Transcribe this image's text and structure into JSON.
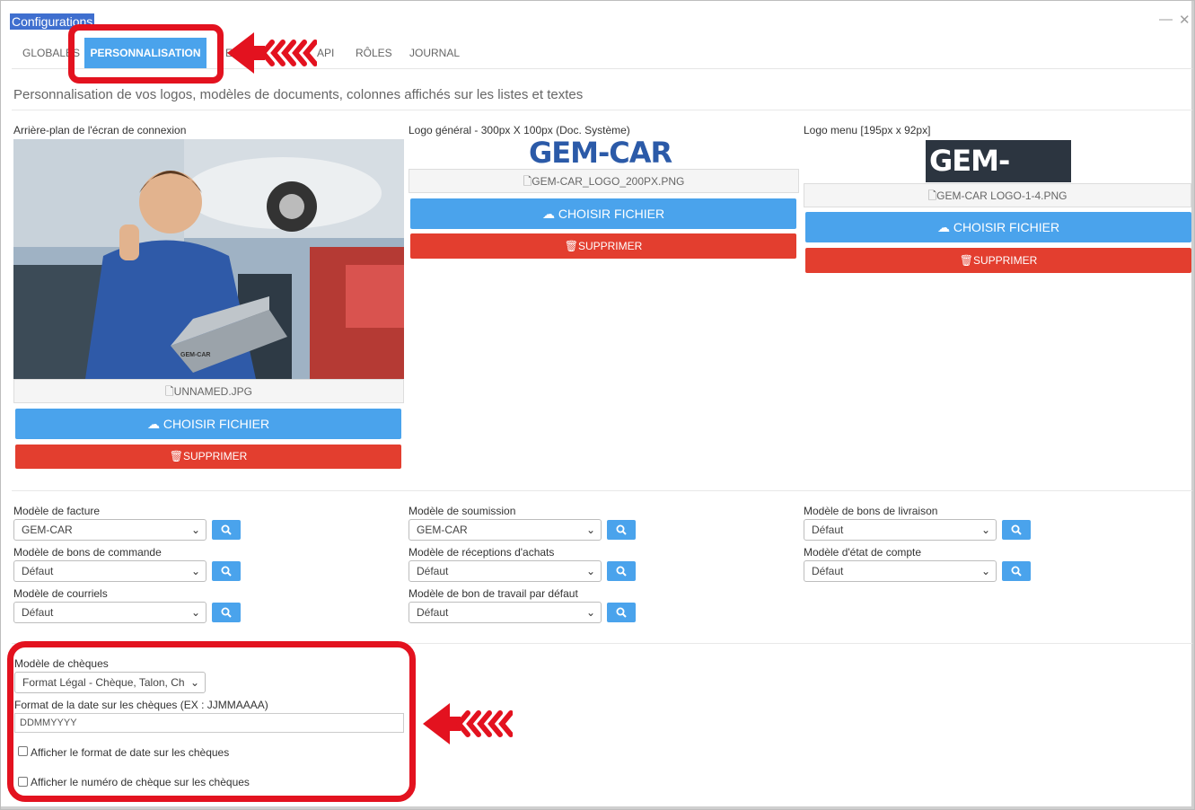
{
  "window": {
    "title": "Configurations",
    "minimize": "—",
    "close": "✕"
  },
  "tabs": [
    {
      "label": "GLOBALES"
    },
    {
      "label": "PERSONNALISATION"
    },
    {
      "label": "E"
    },
    {
      "label": "API"
    },
    {
      "label": "RÔLES"
    },
    {
      "label": "JOURNAL"
    }
  ],
  "subtitle": "Personnalisation de vos logos, modèles de documents, colonnes affichés sur les listes et textes",
  "uploads": [
    {
      "label": "Arrière-plan de l'écran de connexion",
      "file": "UNNAMED.JPG",
      "choose": "CHOISIR FICHIER",
      "delete": "SUPPRIMER"
    },
    {
      "label": "Logo général - 300px X 100px (Doc. Système)",
      "file": "GEM-CAR_LOGO_200PX.PNG",
      "choose": "CHOISIR FICHIER",
      "delete": "SUPPRIMER",
      "logo_text": "GEM-CAR"
    },
    {
      "label": "Logo menu [195px x 92px]",
      "file": "GEM-CAR LOGO-1-4.PNG",
      "choose": "CHOISIR FICHIER",
      "delete": "SUPPRIMER",
      "logo_text": "GEM-CAR"
    }
  ],
  "photo": {
    "laptop_logo": "GEM-CAR"
  },
  "models": [
    {
      "label": "Modèle de facture",
      "value": "GEM-CAR"
    },
    {
      "label": "Modèle de soumission",
      "value": "GEM-CAR"
    },
    {
      "label": "Modèle de bons de livraison",
      "value": "Défaut"
    },
    {
      "label": "Modèle de bons de commande",
      "value": "Défaut"
    },
    {
      "label": "Modèle de réceptions d'achats",
      "value": "Défaut"
    },
    {
      "label": "Modèle d'état de compte",
      "value": "Défaut"
    },
    {
      "label": "Modèle de courriels",
      "value": "Défaut"
    },
    {
      "label": "Modèle de bon de travail par défaut",
      "value": "Défaut"
    }
  ],
  "cheques": {
    "model_label": "Modèle de chèques",
    "model_value": "Format Légal - Chèque, Talon, Chèque",
    "date_label": "Format de la date sur les chèques (EX : JJMMAAAA)",
    "date_value": "DDMMYYYY",
    "show_date_format": "Afficher le format de date sur les chèques",
    "show_cheque_number": "Afficher le numéro de chèque sur les chèques"
  },
  "colors": {
    "accent": "#4aa3ec",
    "danger": "#e33e2f",
    "highlight": "#e3121f",
    "title_bg": "#3f6fcf"
  },
  "icons": {
    "upload": "cloud-upload-icon",
    "delete": "trash-icon",
    "file": "file-icon",
    "search": "search-icon"
  }
}
